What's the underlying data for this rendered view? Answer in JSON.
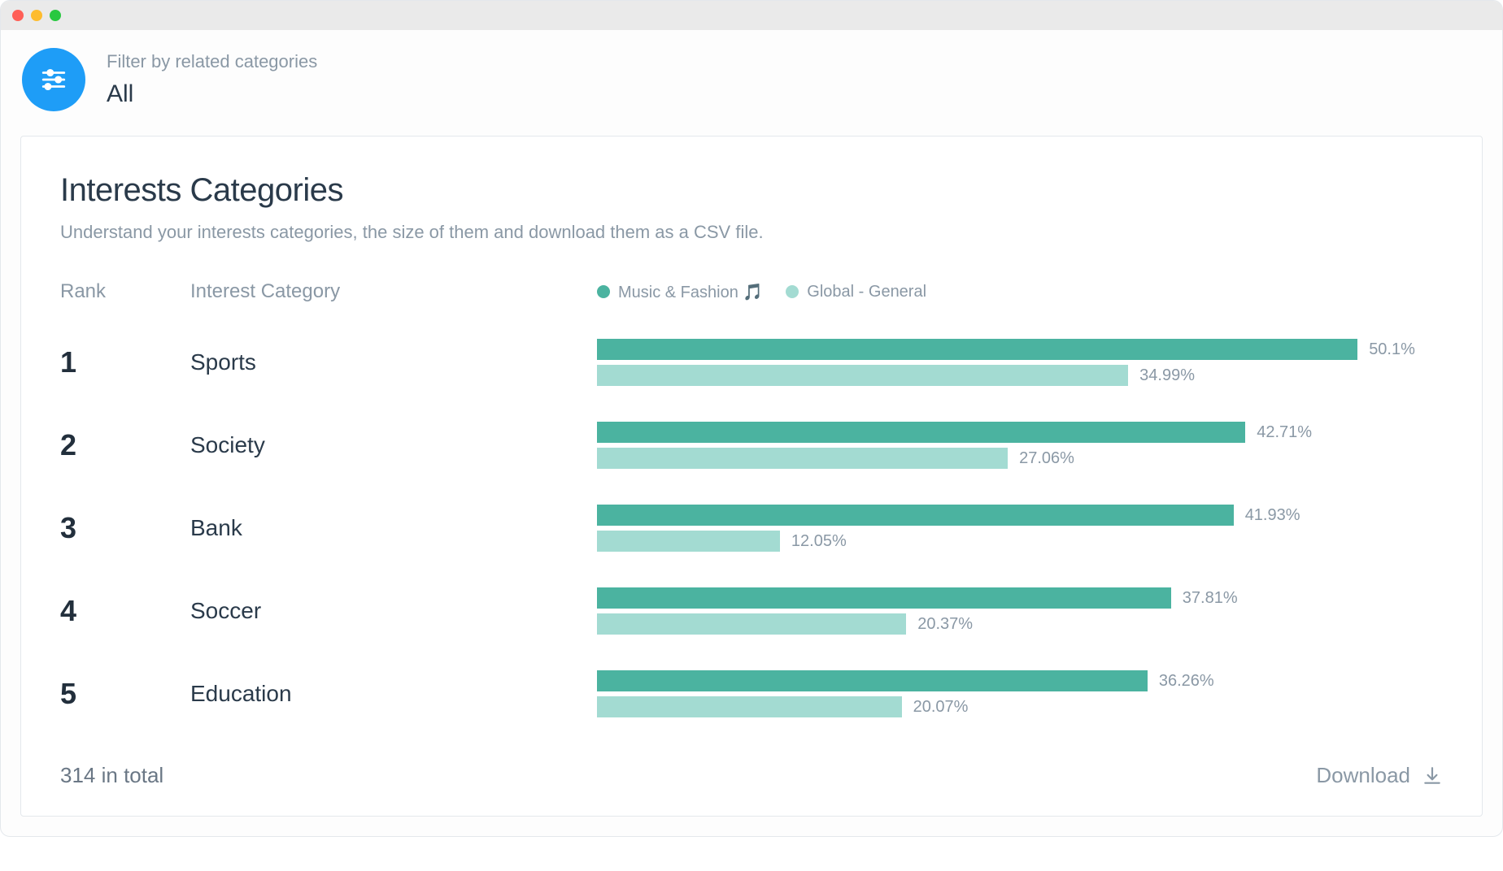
{
  "filter": {
    "label": "Filter by related categories",
    "value": "All"
  },
  "card": {
    "title": "Interests Categories",
    "subtitle": "Understand your interests categories, the size of them and download them as a CSV file.",
    "columns": {
      "rank": "Rank",
      "category": "Interest Category"
    },
    "legend": {
      "primary": "Music & Fashion 🎵",
      "secondary": "Global - General"
    },
    "footer": {
      "total_label": "314 in total",
      "download_label": "Download"
    }
  },
  "chart_data": {
    "type": "bar",
    "orientation": "horizontal",
    "xlabel": "",
    "ylabel": "",
    "xlim": [
      0,
      60
    ],
    "unit": "%",
    "categories": [
      "Sports",
      "Society",
      "Bank",
      "Soccer",
      "Education"
    ],
    "ranks": [
      1,
      2,
      3,
      4,
      5
    ],
    "series": [
      {
        "name": "Music & Fashion 🎵",
        "color": "#4bb3a0",
        "values": [
          50.1,
          42.71,
          41.93,
          37.81,
          36.26
        ]
      },
      {
        "name": "Global - General",
        "color": "#a3dbd2",
        "values": [
          34.99,
          27.06,
          12.05,
          20.37,
          20.07
        ]
      }
    ]
  }
}
